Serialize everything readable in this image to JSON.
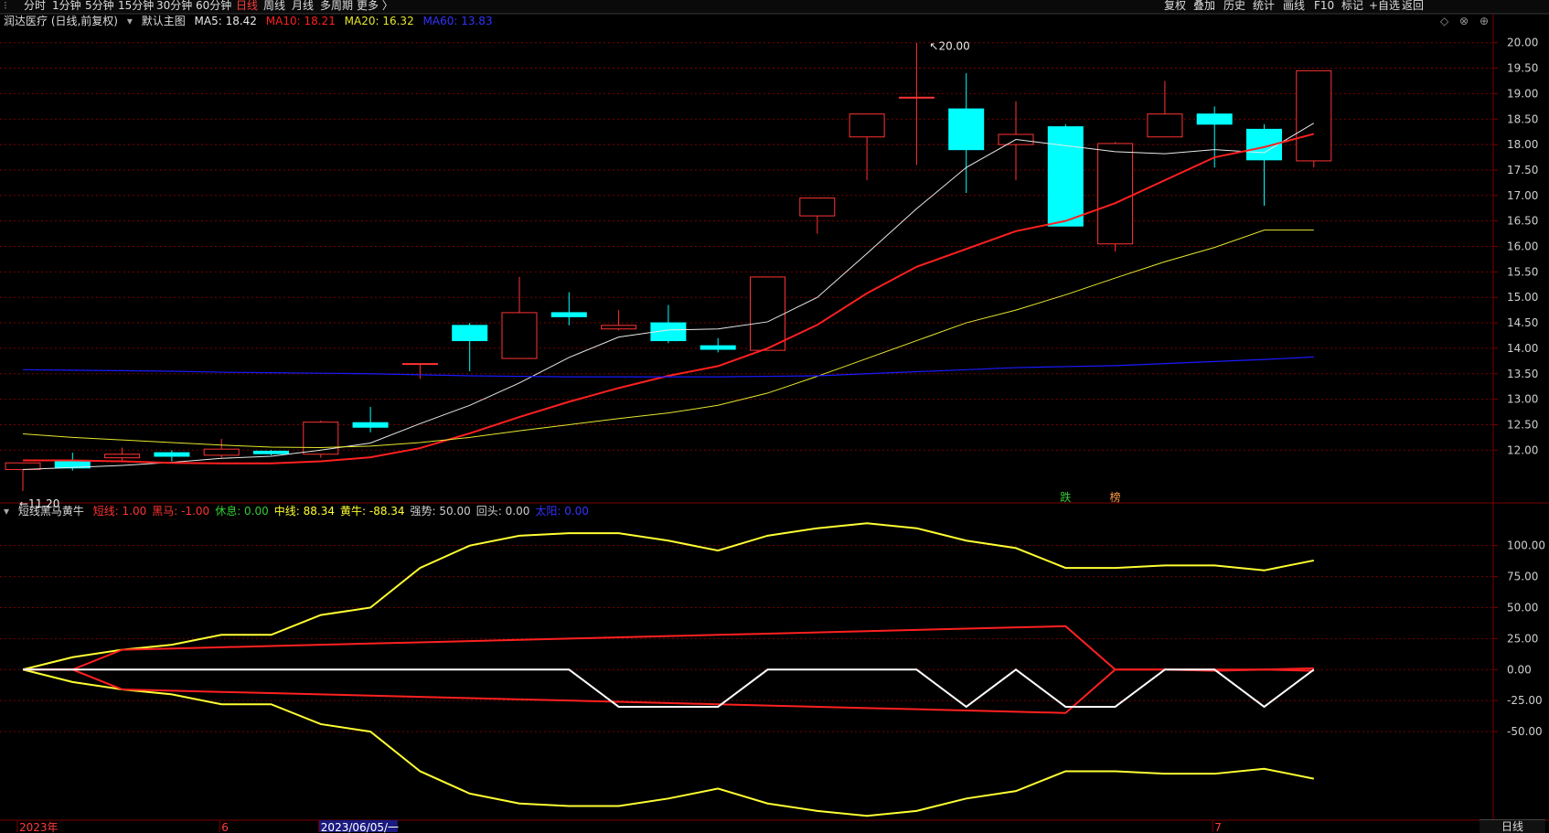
{
  "toolbar": {
    "periods": [
      "分时",
      "1分钟",
      "5分钟",
      "15分钟",
      "30分钟",
      "60分钟",
      "日线",
      "周线",
      "月线",
      "多周期",
      "更多 〉"
    ],
    "active_period": "日线",
    "right_items": [
      "复权",
      "叠加",
      "历史",
      "统计",
      "画线",
      "F10",
      "标记",
      "+自选",
      "返回"
    ]
  },
  "main_legend": {
    "title": "润达医疗 (日线,前复权)",
    "indicator": "默认主图",
    "ma5": "MA5: 18.42",
    "ma10": "MA10: 18.21",
    "ma20": "MA20: 16.32",
    "ma60": "MA60: 13.83"
  },
  "sub_legend": {
    "title": "短线黑马黄牛",
    "items": [
      {
        "text": "短线: 1.00",
        "color": "#ff3333"
      },
      {
        "text": "黑马: -1.00",
        "color": "#ff3333"
      },
      {
        "text": "休息: 0.00",
        "color": "#33cc33"
      },
      {
        "text": "中线: 88.34",
        "color": "#ffff33"
      },
      {
        "text": "黄牛: -88.34",
        "color": "#ffff33"
      },
      {
        "text": "强势: 50.00",
        "color": "#cccccc"
      },
      {
        "text": "回头: 0.00",
        "color": "#cccccc"
      },
      {
        "text": "太阳: 0.00",
        "color": "#3333ff"
      }
    ]
  },
  "window_buttons": [
    "◇",
    "⊗",
    "⊕"
  ],
  "bottom_period_label": "日线",
  "colors": {
    "up": "#ff3333",
    "down": "#00ffff",
    "ma5": "#e8e8e8",
    "ma10": "#ff2020",
    "ma20": "#e6e62e",
    "ma60": "#1a1aff",
    "grid": "#7a0000"
  },
  "chart_data": [
    {
      "type": "candlestick",
      "title": "润达医疗 (日线,前复权)",
      "ylim": [
        11.0,
        20.3
      ],
      "y_ticks": [
        "20.00",
        "19.50",
        "19.00",
        "18.50",
        "18.00",
        "17.50",
        "17.00",
        "16.50",
        "16.00",
        "15.50",
        "15.00",
        "14.50",
        "14.00",
        "13.50",
        "13.00",
        "12.50",
        "12.00"
      ],
      "candles": [
        {
          "o": 11.62,
          "h": 11.75,
          "l": 11.2,
          "c": 11.75
        },
        {
          "o": 11.78,
          "h": 11.95,
          "l": 11.6,
          "c": 11.65
        },
        {
          "o": 11.85,
          "h": 12.05,
          "l": 11.8,
          "c": 11.92
        },
        {
          "o": 11.95,
          "h": 12.0,
          "l": 11.78,
          "c": 11.88
        },
        {
          "o": 11.9,
          "h": 12.22,
          "l": 11.85,
          "c": 12.02
        },
        {
          "o": 11.98,
          "h": 12.0,
          "l": 11.9,
          "c": 11.93
        },
        {
          "o": 11.92,
          "h": 12.58,
          "l": 11.85,
          "c": 12.55
        },
        {
          "o": 12.54,
          "h": 12.85,
          "l": 12.35,
          "c": 12.45
        },
        {
          "o": 13.7,
          "h": 13.7,
          "l": 13.4,
          "c": 13.7
        },
        {
          "o": 14.45,
          "h": 14.5,
          "l": 13.55,
          "c": 14.15
        },
        {
          "o": 13.8,
          "h": 15.4,
          "l": 13.8,
          "c": 14.7
        },
        {
          "o": 14.7,
          "h": 15.1,
          "l": 14.45,
          "c": 14.62
        },
        {
          "o": 14.38,
          "h": 14.75,
          "l": 14.35,
          "c": 14.45
        },
        {
          "o": 14.5,
          "h": 14.85,
          "l": 14.1,
          "c": 14.15
        },
        {
          "o": 14.05,
          "h": 14.2,
          "l": 13.92,
          "c": 13.98
        },
        {
          "o": 13.96,
          "h": 15.4,
          "l": 13.96,
          "c": 15.4
        },
        {
          "o": 16.6,
          "h": 16.95,
          "l": 16.25,
          "c": 16.95
        },
        {
          "o": 18.15,
          "h": 18.6,
          "l": 17.3,
          "c": 18.6
        },
        {
          "o": 18.93,
          "h": 20.0,
          "l": 17.6,
          "c": 18.93
        },
        {
          "o": 18.7,
          "h": 19.4,
          "l": 17.05,
          "c": 17.9
        },
        {
          "o": 18.0,
          "h": 18.85,
          "l": 17.3,
          "c": 18.2
        },
        {
          "o": 18.35,
          "h": 18.4,
          "l": 16.4,
          "c": 16.4
        },
        {
          "o": 16.05,
          "h": 18.05,
          "l": 15.9,
          "c": 18.02
        },
        {
          "o": 18.15,
          "h": 19.25,
          "l": 18.15,
          "c": 18.6
        },
        {
          "o": 18.6,
          "h": 18.75,
          "l": 17.55,
          "c": 18.4
        },
        {
          "o": 18.3,
          "h": 18.4,
          "l": 16.8,
          "c": 17.7
        },
        {
          "o": 17.68,
          "h": 19.45,
          "l": 17.55,
          "c": 19.45
        }
      ],
      "series": [
        {
          "name": "MA5",
          "values": [
            11.62,
            11.66,
            11.7,
            11.76,
            11.84,
            11.88,
            12.0,
            12.14,
            12.52,
            12.88,
            13.32,
            13.82,
            14.22,
            14.36,
            14.38,
            14.52,
            15.0,
            15.86,
            16.74,
            17.55,
            18.1,
            17.98,
            17.86,
            17.82,
            17.9,
            17.84,
            18.42
          ]
        },
        {
          "name": "MA10",
          "values": [
            11.8,
            11.8,
            11.78,
            11.75,
            11.74,
            11.74,
            11.78,
            11.86,
            12.04,
            12.33,
            12.65,
            12.95,
            13.22,
            13.46,
            13.65,
            14.0,
            14.46,
            15.08,
            15.6,
            15.95,
            16.3,
            16.5,
            16.85,
            17.3,
            17.75,
            17.95,
            18.21
          ]
        },
        {
          "name": "MA20",
          "values": [
            12.32,
            12.25,
            12.2,
            12.15,
            12.1,
            12.06,
            12.05,
            12.08,
            12.15,
            12.25,
            12.38,
            12.5,
            12.62,
            12.73,
            12.88,
            13.12,
            13.45,
            13.8,
            14.15,
            14.5,
            14.75,
            15.05,
            15.38,
            15.7,
            15.98,
            16.32,
            16.32
          ]
        },
        {
          "name": "MA60",
          "values": [
            13.58,
            13.57,
            13.56,
            13.55,
            13.53,
            13.52,
            13.51,
            13.5,
            13.48,
            13.46,
            13.45,
            13.44,
            13.44,
            13.44,
            13.44,
            13.45,
            13.46,
            13.5,
            13.54,
            13.58,
            13.62,
            13.64,
            13.66,
            13.7,
            13.74,
            13.78,
            13.83
          ]
        }
      ],
      "annotations": [
        {
          "text": "20.00",
          "candle_index": 18
        },
        {
          "text": "←11.20",
          "candle_index": 0
        },
        {
          "text": "跌",
          "candle_index": 21
        },
        {
          "text": "榜",
          "candle_index": 22
        }
      ]
    },
    {
      "type": "line",
      "title": "短线黑马黄牛",
      "ylim": [
        -120,
        130
      ],
      "y_ticks": [
        "100.00",
        "75.00",
        "50.00",
        "25.00",
        "0.00",
        "-25.00",
        "-50.00"
      ],
      "x_labels": [
        "2023年",
        "6",
        "2023/06/05/一",
        "7"
      ],
      "series": [
        {
          "name": "中线",
          "values": [
            0,
            10,
            16,
            20,
            28,
            28,
            44,
            50,
            82,
            100,
            108,
            110,
            110,
            104,
            96,
            108,
            114,
            118,
            114,
            104,
            98,
            82,
            82,
            84,
            84,
            80,
            88
          ]
        },
        {
          "name": "黄牛",
          "values": [
            0,
            -10,
            -16,
            -20,
            -28,
            -28,
            -44,
            -50,
            -82,
            -100,
            -108,
            -110,
            -110,
            -104,
            -96,
            -108,
            -114,
            -118,
            -114,
            -104,
            -98,
            -82,
            -82,
            -84,
            -84,
            -80,
            -88
          ]
        },
        {
          "name": "短线",
          "values": [
            0,
            0,
            16,
            17,
            18,
            19,
            20,
            21,
            22,
            23,
            24,
            25,
            26,
            27,
            28,
            29,
            30,
            31,
            32,
            33,
            34,
            35,
            0,
            0,
            0,
            0,
            1
          ]
        },
        {
          "name": "黑马",
          "values": [
            0,
            0,
            -16,
            -17,
            -18,
            -19,
            -20,
            -21,
            -22,
            -23,
            -24,
            -25,
            -26,
            -27,
            -28,
            -29,
            -30,
            -31,
            -32,
            -33,
            -34,
            -35,
            0,
            0,
            -1,
            0,
            -1
          ]
        },
        {
          "name": "强势",
          "values": [
            0,
            0,
            0,
            0,
            0,
            0,
            0,
            0,
            0,
            0,
            0,
            0,
            -30,
            -30,
            -30,
            0,
            0,
            0,
            0,
            -30,
            0,
            -30,
            -30,
            0,
            0,
            -30,
            0
          ]
        }
      ]
    }
  ]
}
